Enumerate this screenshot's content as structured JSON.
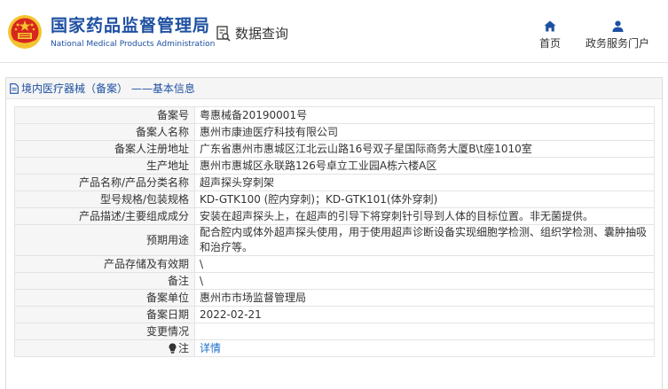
{
  "brand": {
    "name_cn": "国家药品监督管理局",
    "name_en": "National Medical Products Administration"
  },
  "header": {
    "query_label": "数据查询",
    "nav": [
      {
        "label": "首页",
        "icon": "home-icon"
      },
      {
        "label": "政务服务门户",
        "icon": "user-icon"
      }
    ]
  },
  "breadcrumb": {
    "icon": "document-icon",
    "text": "境内医疗器械（备案） ——基本信息"
  },
  "record": {
    "rows": [
      {
        "label": "备案号",
        "value": "粤惠械备20190001号"
      },
      {
        "label": "备案人名称",
        "value": "惠州市康迪医疗科技有限公司"
      },
      {
        "label": "备案人注册地址",
        "value": "广东省惠州市惠城区江北云山路16号双子星国际商务大厦B\\t座1010室"
      },
      {
        "label": "生产地址",
        "value": "惠州市惠城区永联路126号卓立工业园A栋六楼A区"
      },
      {
        "label": "产品名称/产品分类名称",
        "value": "超声探头穿刺架"
      },
      {
        "label": "型号规格/包装规格",
        "value": "KD-GTK100 (腔内穿刺)；KD-GTK101(体外穿刺)"
      },
      {
        "label": "产品描述/主要组成成分",
        "value": "安装在超声探头上，在超声的引导下将穿刺针引导到人体的目标位置。非无菌提供。"
      },
      {
        "label": "预期用途",
        "value": "配合腔内或体外超声探头使用，用于使用超声诊断设备实现细胞学检测、组织学检测、囊肿抽吸和治疗等。"
      },
      {
        "label": "产品存储及有效期",
        "value": "\\"
      },
      {
        "label": "备注",
        "value": "\\"
      },
      {
        "label": "备案单位",
        "value": "惠州市市场监督管理局"
      },
      {
        "label": "备案日期",
        "value": "2022-02-21"
      },
      {
        "label": "变更情况",
        "value": ""
      }
    ],
    "note_row": {
      "label": "注",
      "icon": "lightbulb-icon",
      "link": "详情"
    }
  },
  "colors": {
    "brand_blue": "#1e50a2",
    "link_blue": "#1e6fc8",
    "emblem_red": "#d7261e",
    "emblem_gold": "#f4c430"
  }
}
